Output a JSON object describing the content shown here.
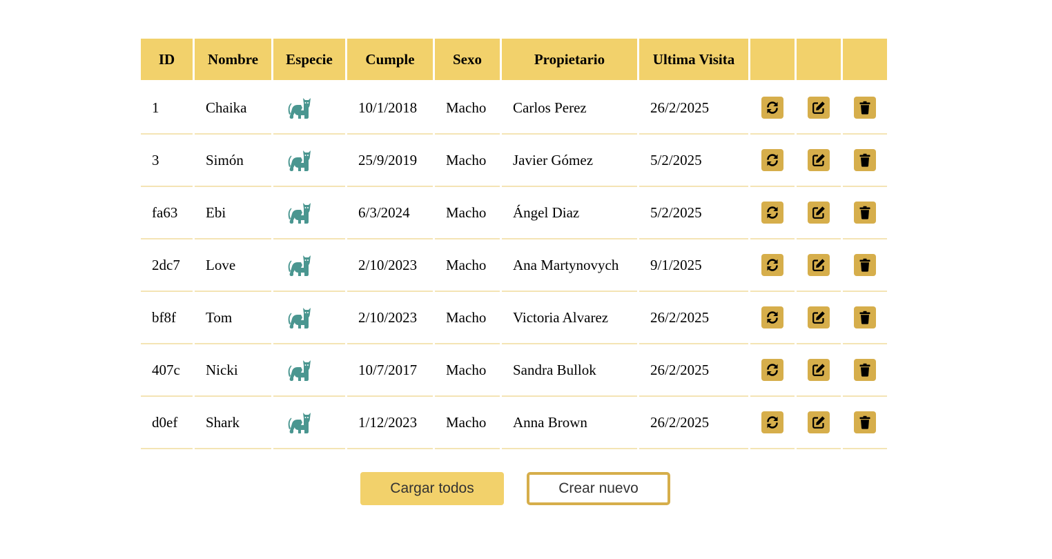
{
  "table": {
    "headers": [
      "ID",
      "Nombre",
      "Especie",
      "Cumple",
      "Sexo",
      "Propietario",
      "Ultima Visita",
      "",
      "",
      ""
    ],
    "rows": [
      {
        "id": "1",
        "nombre": "Chaika",
        "especie": "cat-icon",
        "cumple": "10/1/2018",
        "sexo": "Macho",
        "propietario": "Carlos Perez",
        "ultima": "26/2/2025"
      },
      {
        "id": "3",
        "nombre": "Simón",
        "especie": "cat-icon",
        "cumple": "25/9/2019",
        "sexo": "Macho",
        "propietario": "Javier Gómez",
        "ultima": "5/2/2025"
      },
      {
        "id": "fa63",
        "nombre": "Ebi",
        "especie": "cat-icon",
        "cumple": "6/3/2024",
        "sexo": "Macho",
        "propietario": "Ángel Diaz",
        "ultima": "5/2/2025"
      },
      {
        "id": "2dc7",
        "nombre": "Love",
        "especie": "cat-icon",
        "cumple": "2/10/2023",
        "sexo": "Macho",
        "propietario": "Ana Martynovych",
        "ultima": "9/1/2025"
      },
      {
        "id": "bf8f",
        "nombre": "Tom",
        "especie": "cat-icon",
        "cumple": "2/10/2023",
        "sexo": "Macho",
        "propietario": "Victoria Alvarez",
        "ultima": "26/2/2025"
      },
      {
        "id": "407c",
        "nombre": "Nicki",
        "especie": "cat-icon",
        "cumple": "10/7/2017",
        "sexo": "Macho",
        "propietario": "Sandra Bullok",
        "ultima": "26/2/2025"
      },
      {
        "id": "d0ef",
        "nombre": "Shark",
        "especie": "cat-icon",
        "cumple": "1/12/2023",
        "sexo": "Macho",
        "propietario": "Anna Brown",
        "ultima": "26/2/2025"
      }
    ],
    "actions": [
      "refresh-icon",
      "edit-icon",
      "trash-icon"
    ]
  },
  "buttons": {
    "load_all": "Cargar todos",
    "create_new": "Crear nuevo"
  },
  "colors": {
    "header_bg": "#f2d16b",
    "action_bg": "#d6ae4b",
    "cat_icon": "#4a9690",
    "row_border": "#f4e4b4"
  }
}
